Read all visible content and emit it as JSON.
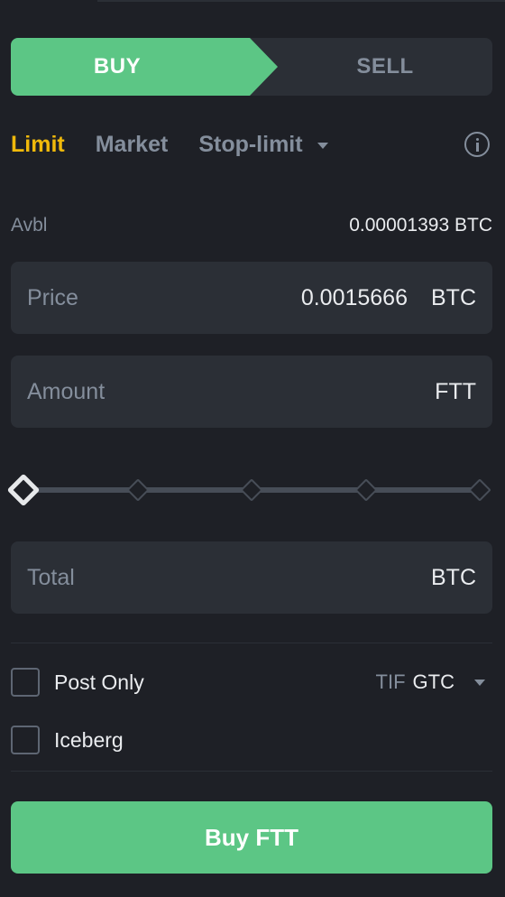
{
  "side_toggle": {
    "buy_label": "BUY",
    "sell_label": "SELL",
    "selected": "BUY"
  },
  "order_types": {
    "active": "Limit",
    "tabs": [
      {
        "label": "Limit"
      },
      {
        "label": "Market"
      },
      {
        "label": "Stop-limit"
      }
    ]
  },
  "available": {
    "label": "Avbl",
    "value": "0.00001393 BTC"
  },
  "price_field": {
    "label": "Price",
    "value": "0.0015666",
    "unit": "BTC"
  },
  "amount_field": {
    "label": "Amount",
    "value": "",
    "unit": "FTT"
  },
  "slider": {
    "percent": 0,
    "marks": [
      0,
      25,
      50,
      75,
      100
    ]
  },
  "total_field": {
    "label": "Total",
    "value": "",
    "unit": "BTC"
  },
  "options": {
    "post_only": {
      "label": "Post Only",
      "checked": false
    },
    "iceberg": {
      "label": "Iceberg",
      "checked": false
    },
    "tif": {
      "label": "TIF",
      "value": "GTC"
    }
  },
  "submit": {
    "label": "Buy FTT"
  },
  "colors": {
    "background": "#1e2026",
    "panel": "#2b2f36",
    "buy_green": "#5cc685",
    "active_tab": "#f0b90b",
    "muted_text": "#848e9c",
    "text": "#eaecef"
  },
  "icons": [
    "info-icon",
    "chevron-down-icon"
  ]
}
